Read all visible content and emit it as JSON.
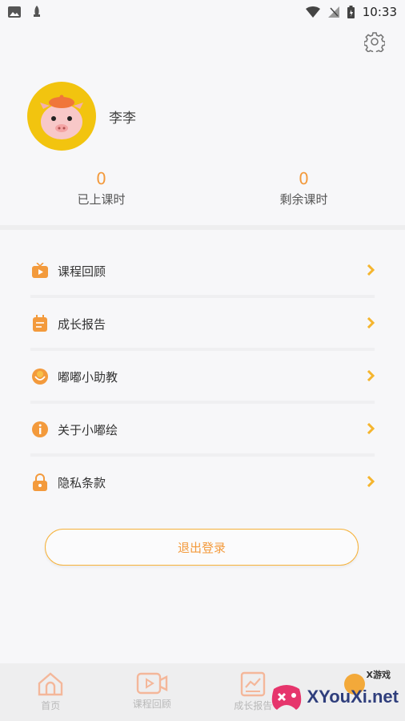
{
  "status_bar": {
    "time": "10:33"
  },
  "profile": {
    "username": "李李"
  },
  "stats": [
    {
      "value": "0",
      "label": "已上课时"
    },
    {
      "value": "0",
      "label": "剩余课时"
    }
  ],
  "menu": [
    {
      "label": "课程回顾",
      "icon": "tv-icon"
    },
    {
      "label": "成长报告",
      "icon": "report-icon"
    },
    {
      "label": "嘟嘟小助教",
      "icon": "assistant-icon"
    },
    {
      "label": "关于小嘟绘",
      "icon": "info-icon"
    },
    {
      "label": "隐私条款",
      "icon": "lock-icon"
    }
  ],
  "logout_label": "退出登录",
  "tabbar": [
    {
      "label": "首页"
    },
    {
      "label": "课程回顾"
    },
    {
      "label": "成长报告"
    },
    {
      "label": ""
    }
  ],
  "watermark": {
    "text": "XYouXi.net",
    "small": "X游戏"
  },
  "colors": {
    "accent": "#f39a3c",
    "avatar_bg": "#f2c40f",
    "chevron": "#f5b52e"
  }
}
